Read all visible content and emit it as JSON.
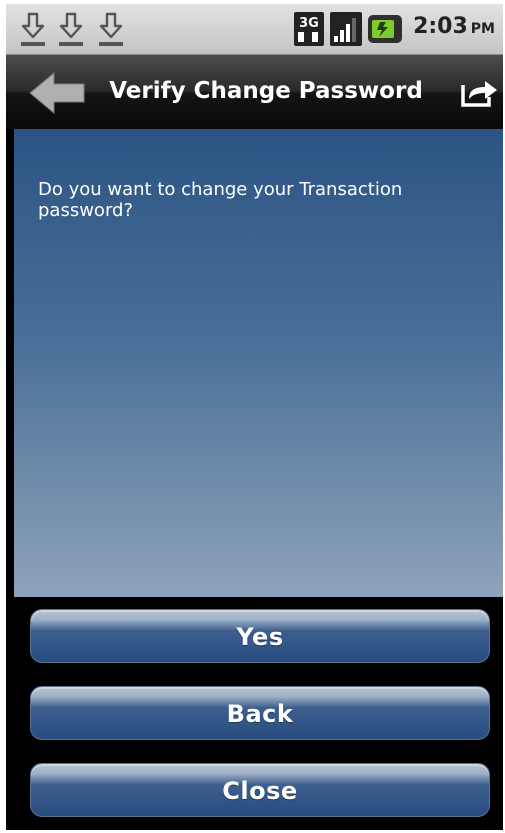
{
  "status_bar": {
    "icons": [
      "download-icon",
      "download-icon",
      "download-icon",
      "3g-icon",
      "signal-icon",
      "battery-icon"
    ],
    "time": "2:03",
    "ampm": "PM"
  },
  "header": {
    "title": "Verify Change Password",
    "back_icon": "back-arrow-icon",
    "share_icon": "share-icon"
  },
  "content": {
    "prompt": "Do you want to change your Transaction password?"
  },
  "buttons": {
    "yes_label": "Yes",
    "back_label": "Back",
    "close_label": "Close"
  },
  "colors": {
    "panel_top": "#2c5484",
    "panel_bottom": "#8ea3b9",
    "button_blue": "#274c80"
  }
}
